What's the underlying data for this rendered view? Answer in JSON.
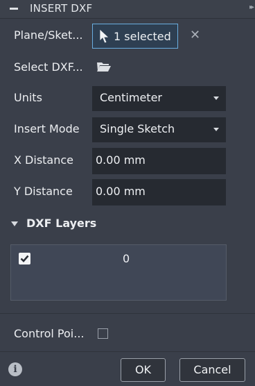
{
  "dialog": {
    "title": "INSERT DXF"
  },
  "rows": {
    "plane_label": "Plane/Sket...",
    "plane_button": "1 selected",
    "select_label": "Select DXF...",
    "units_label": "Units",
    "units_value": "Centimeter",
    "mode_label": "Insert Mode",
    "mode_value": "Single Sketch",
    "x_label": "X Distance",
    "x_value": "0.00 mm",
    "y_label": "Y Distance",
    "y_value": "0.00 mm"
  },
  "layers": {
    "title": "DXF Layers",
    "items": [
      {
        "name": "0",
        "checked": true
      }
    ]
  },
  "control_points": {
    "label": "Control Poi...",
    "checked": false
  },
  "footer": {
    "ok": "OK",
    "cancel": "Cancel"
  },
  "icons": [
    "collapse-icon",
    "more-icon",
    "cursor-icon",
    "clear-icon",
    "folder-icon",
    "dropdown-arrow-icon",
    "expand-triangle-icon",
    "check-icon",
    "info-icon"
  ]
}
